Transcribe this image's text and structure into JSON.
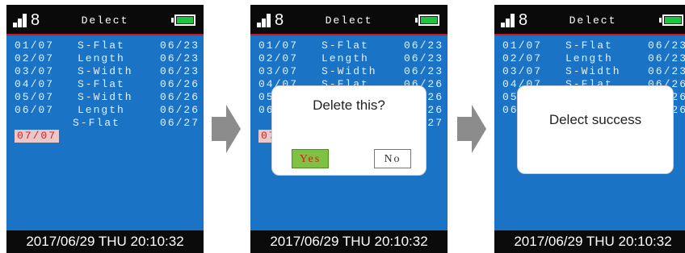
{
  "colors": {
    "screen_bg": "#1a73c4",
    "topbar_bg": "#0a0a0a",
    "accent_red": "#d01818",
    "battery_green": "#1dc642",
    "yes_button": "#7ec143",
    "arrow": "#8c8c8c"
  },
  "status": {
    "signal_icon": "signal-bars-icon",
    "signal_level": "8",
    "title": "Delect",
    "battery_icon": "battery-full-icon",
    "datetime": "2017/06/29  THU  20:10:32"
  },
  "records": [
    {
      "date": "01/07",
      "type": "S-Flat",
      "num": "06/23"
    },
    {
      "date": "02/07",
      "type": "Length",
      "num": "06/23"
    },
    {
      "date": "03/07",
      "type": "S-Width",
      "num": "06/23"
    },
    {
      "date": "04/07",
      "type": "S-Flat",
      "num": "06/26"
    },
    {
      "date": "05/07",
      "type": "S-Width",
      "num": "06/26"
    },
    {
      "date": "06/07",
      "type": "Length",
      "num": "06/26"
    },
    {
      "date": "",
      "type": "S-Flat",
      "num": "06/27"
    }
  ],
  "selected_item": "07/07",
  "confirm_dialog": {
    "message": "Delete this?",
    "yes_label": "Yes",
    "no_label": "No"
  },
  "success_dialog": {
    "message": "Delect success"
  }
}
